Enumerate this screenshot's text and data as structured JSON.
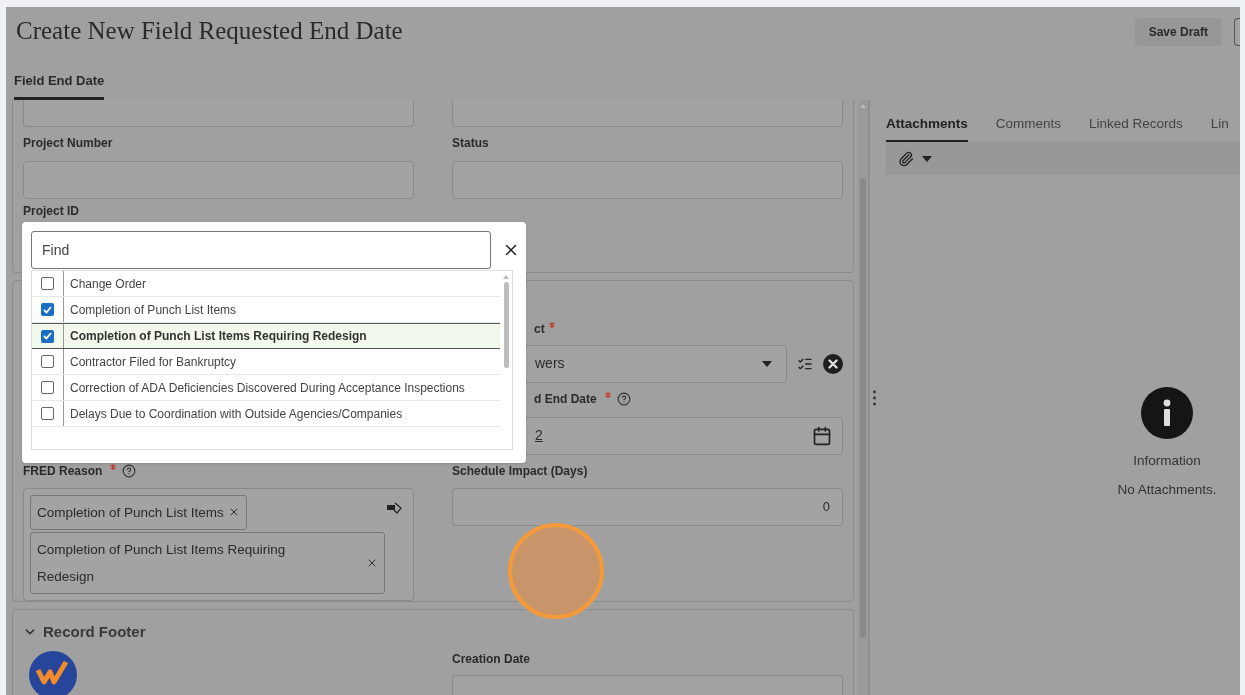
{
  "page": {
    "title": "Create New Field Requested End Date",
    "save_button": "Save Draft"
  },
  "tabs": [
    {
      "label": "Field End Date",
      "selected": true
    }
  ],
  "form": {
    "top_fields": [
      {
        "label": "Project Number"
      },
      {
        "label": "Status"
      }
    ],
    "project_id_label": "Project ID",
    "project_field": {
      "label": "ct",
      "required": true,
      "value": "wers"
    },
    "end_date_field": {
      "label": "d End Date",
      "required": true,
      "value": "2"
    },
    "fred_reason": {
      "label": "FRED Reason",
      "required": true,
      "chips": [
        "Completion of Punch List Items",
        "Completion of Punch List Items Requiring Redesign"
      ]
    },
    "schedule_impact": {
      "label": "Schedule Impact (Days)",
      "value": "0"
    },
    "footer_section": {
      "title": "Record Footer",
      "expanded": true,
      "fields": [
        {
          "label": "Creation Date"
        }
      ]
    }
  },
  "picker": {
    "placeholder": "Find",
    "options": [
      {
        "label": "Change Order",
        "checked": false,
        "selected": false
      },
      {
        "label": "Completion of Punch List Items",
        "checked": true,
        "selected": false
      },
      {
        "label": "Completion of Punch List Items Requiring Redesign",
        "checked": true,
        "selected": true
      },
      {
        "label": "Contractor Filed for Bankruptcy",
        "checked": false,
        "selected": false
      },
      {
        "label": "Correction of ADA Deficiencies Discovered During Acceptance Inspections",
        "checked": false,
        "selected": false
      },
      {
        "label": "Delays Due to Coordination with Outside Agencies/Companies",
        "checked": false,
        "selected": false
      }
    ]
  },
  "side_panel": {
    "tabs": [
      {
        "label": "Attachments",
        "selected": true
      },
      {
        "label": "Comments",
        "selected": false
      },
      {
        "label": "Linked Records",
        "selected": false
      },
      {
        "label": "Lin",
        "selected": false
      }
    ],
    "empty_title": "Information",
    "empty_message": "No Attachments."
  }
}
